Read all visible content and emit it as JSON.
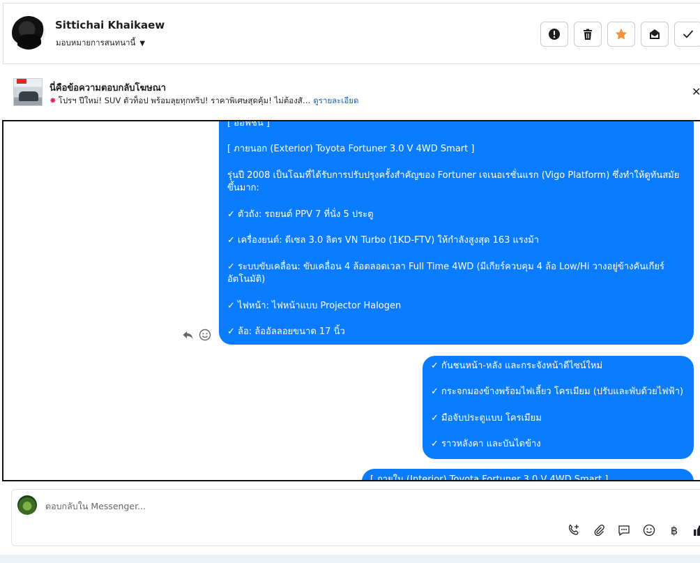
{
  "header": {
    "contact_name": "Sittichai Khaikaew",
    "assign_label": "มอบหมายการสนทนานี้",
    "actions": [
      {
        "icon": "alert-icon",
        "label": "mark-spam"
      },
      {
        "icon": "trash-icon",
        "label": "delete"
      },
      {
        "icon": "star-icon",
        "label": "star"
      },
      {
        "icon": "mark-unread-icon",
        "label": "mark-unread"
      },
      {
        "icon": "check-icon",
        "label": "mark-done"
      }
    ],
    "star_color": "#f7923b"
  },
  "ad_reply": {
    "title": "นี่คือข้อความตอบกลับโฆษณา",
    "subtitle": "โปรฯ ปีใหม่! SUV ตัวท็อป พร้อมลุยทุกทริป! ราคาพิเศษสุดคุ้ม! ไม่ต้องสั…",
    "details_link": "ดูรายละเอียด",
    "close_icon": "close-icon"
  },
  "messages": {
    "bubble_color": "#0a7cff",
    "m1": {
      "lines": [
        "[ ออฟชั่น ]",
        "",
        "[ ภายนอก (Exterior) Toyota Fortuner 3.0 V 4WD Smart ]",
        "",
        "รุ่นปี 2008 เป็นโฉมที่ได้รับการปรับปรุงครั้งสำคัญของ Fortuner เจเนอเรชั่นแรก (Vigo Platform) ซึ่งทำให้ดูทันสมัยขึ้นมาก:",
        "",
        "✓ ตัวถัง: รถยนต์ PPV 7 ที่นั่ง 5 ประตู",
        "",
        "✓ เครื่องยนต์: ดีเซล 3.0 ลิตร VN Turbo (1KD-FTV) ให้กำลังสูงสุด 163 แรงม้า",
        "",
        "✓ ระบบขับเคลื่อน: ขับเคลื่อน 4 ล้อตลอดเวลา Full Time 4WD (มีเกียร์ควบคุม 4 ล้อ Low/Hi วางอยู่ข้างคันเกียร์อัตโนมัติ)",
        "",
        "✓ ไฟหน้า: ไฟหน้าแบบ Projector Halogen",
        "",
        "✓ ล้อ: ล้ออัลลอยขนาด 17 นิ้ว"
      ]
    },
    "m2": {
      "lines": [
        "✓ กันชนหน้า-หลัง และกระจังหน้าดีไซน์ใหม่",
        "",
        "✓ กระจกมองข้างพร้อมไฟเลี้ยว โครเมียม (ปรับและพับด้วยไฟฟ้า)",
        "",
        "✓ มือจับประตูแบบ โครเมียม",
        "",
        "✓ ราวหลังคา และบันไดข้าง"
      ]
    },
    "m3": {
      "lines": [
        "[ ภายใน (Interior) Toyota Fortuner 3.0 V 4WD Smart ]"
      ]
    }
  },
  "composer": {
    "placeholder": "ตอบกลับใน Messenger...",
    "tools": [
      "call-add-icon",
      "attachment-icon",
      "saved-reply-icon",
      "emoji-icon",
      "baht-icon",
      "like-icon"
    ],
    "baht_symbol": "฿"
  }
}
